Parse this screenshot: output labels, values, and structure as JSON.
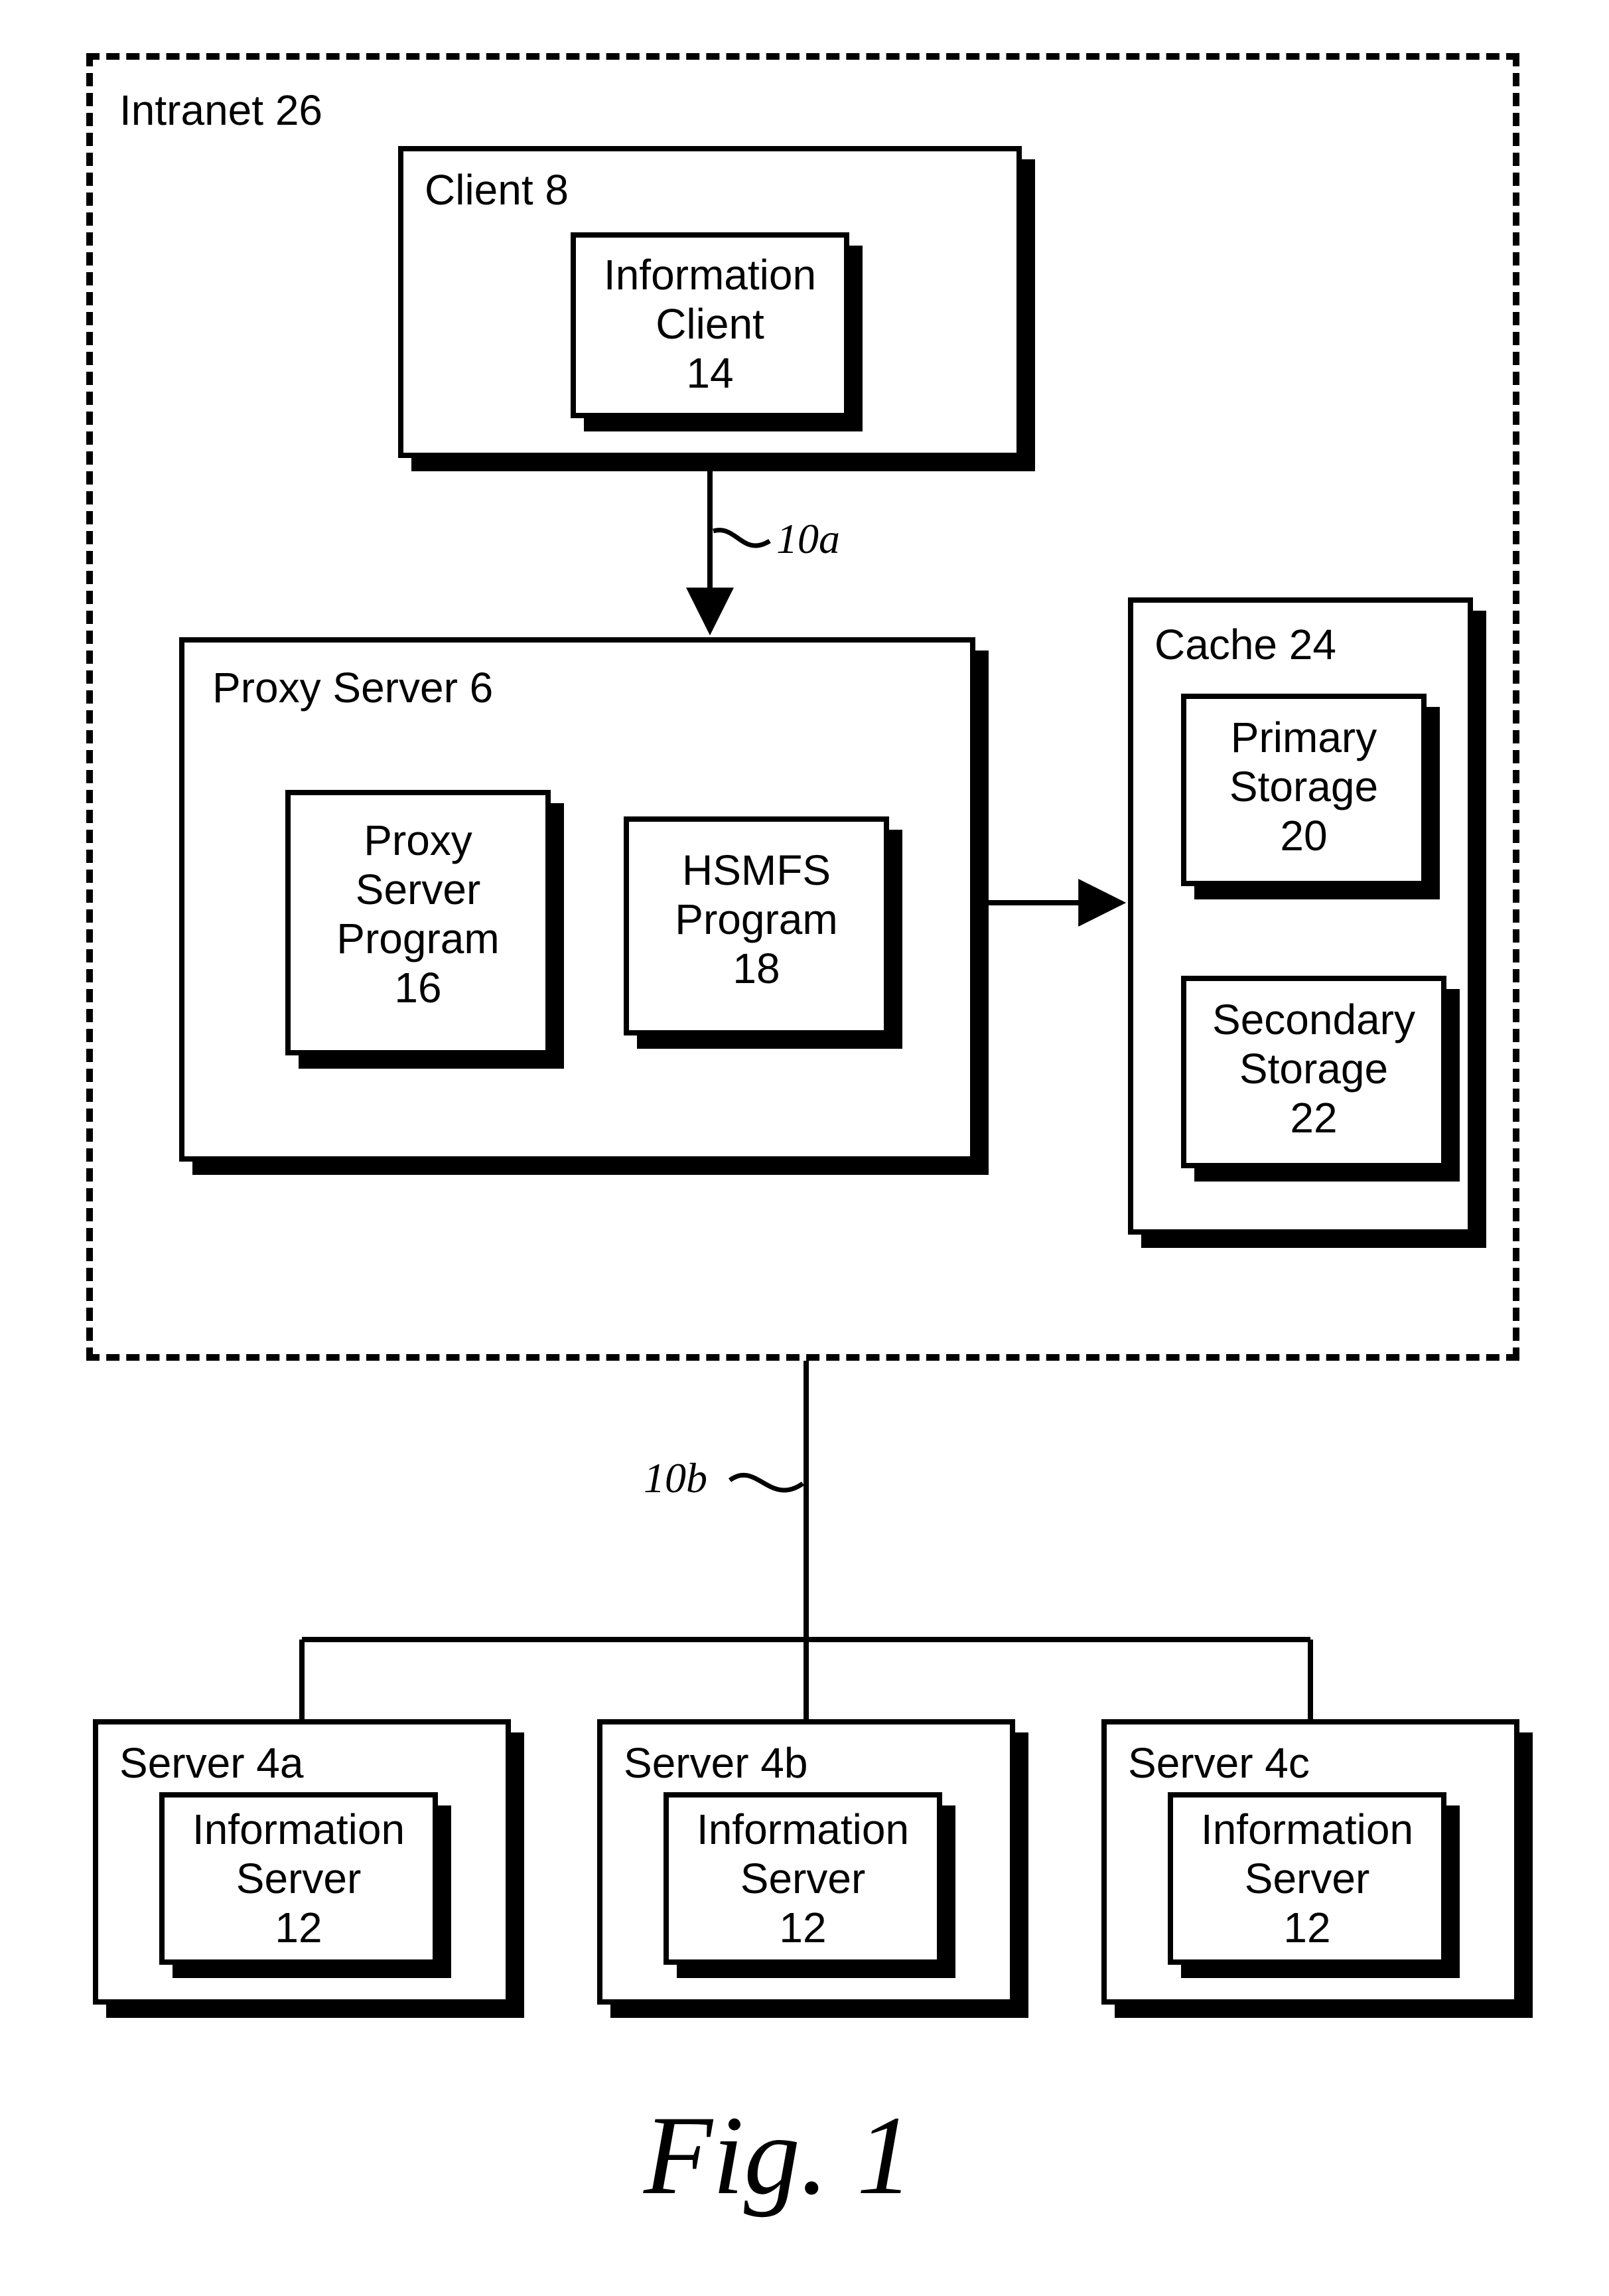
{
  "intranet": {
    "label": "Intranet 26"
  },
  "client": {
    "title": "Client 8",
    "inner": {
      "l1": "Information",
      "l2": "Client",
      "l3": "14"
    }
  },
  "proxy": {
    "title": "Proxy Server 6",
    "prog1": {
      "l1": "Proxy",
      "l2": "Server",
      "l3": "Program",
      "l4": "16"
    },
    "prog2": {
      "l1": "HSMFS",
      "l2": "Program",
      "l3": "18"
    }
  },
  "cache": {
    "title": "Cache 24",
    "primary": {
      "l1": "Primary",
      "l2": "Storage",
      "l3": "20"
    },
    "secondary": {
      "l1": "Secondary",
      "l2": "Storage",
      "l3": "22"
    }
  },
  "links": {
    "a": "10a",
    "b": "10b"
  },
  "servers": {
    "a": {
      "title": "Server 4a"
    },
    "b": {
      "title": "Server 4b"
    },
    "c": {
      "title": "Server 4c"
    },
    "inner": {
      "l1": "Information",
      "l2": "Server",
      "l3": "12"
    }
  },
  "figure": "Fig. 1"
}
